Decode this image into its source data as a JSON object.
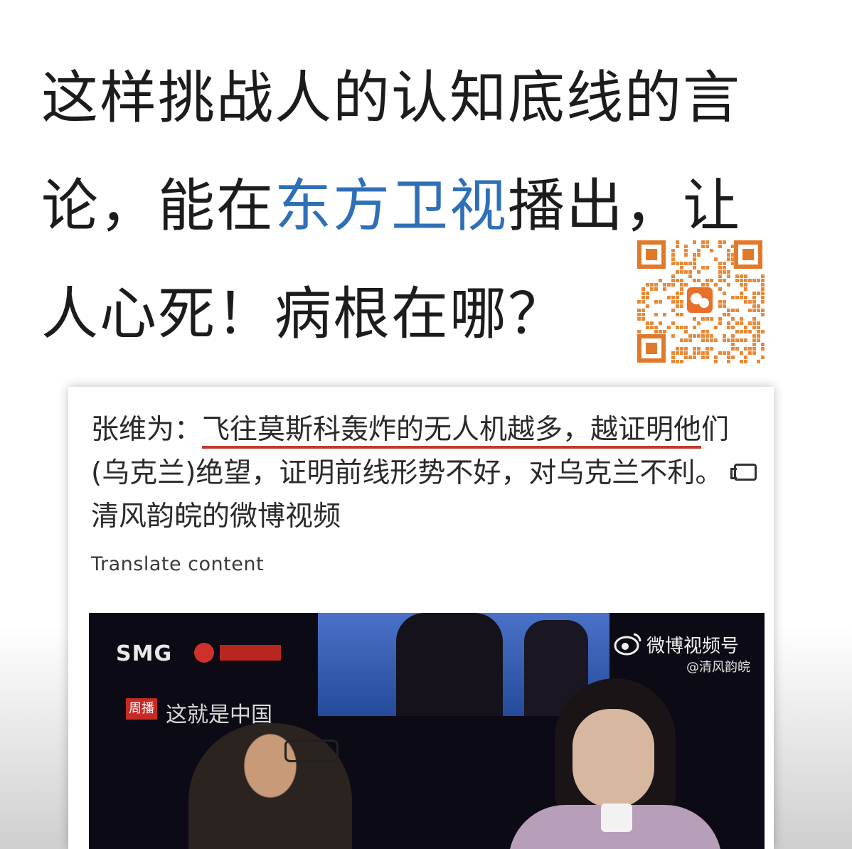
{
  "headline": {
    "line1": "这样挑战人的认知底线的言",
    "line2_pre": "论，能在",
    "line2_highlight": "东方卫视",
    "line2_post": "播出，让",
    "line3": "人心死！病根在哪？",
    "highlight_color": "#2f6fb8"
  },
  "post": {
    "author": "张维为：",
    "quote_underlined": "飞往莫斯科轰炸的无人机越多，越证明他",
    "quote_rest": "们(乌克兰)绝望，证明前线形势不好，对乌克兰不利。",
    "video_link_label": "清风韵皖的微博视频",
    "translate_label": "Translate content",
    "underline_color": "#c0392b"
  },
  "video": {
    "broadcaster_logo": "SMG",
    "program_badge": "周播",
    "program_name": "这就是中国",
    "watermark_label": "微博视频号",
    "watermark_sub": "@清风韵皖"
  }
}
